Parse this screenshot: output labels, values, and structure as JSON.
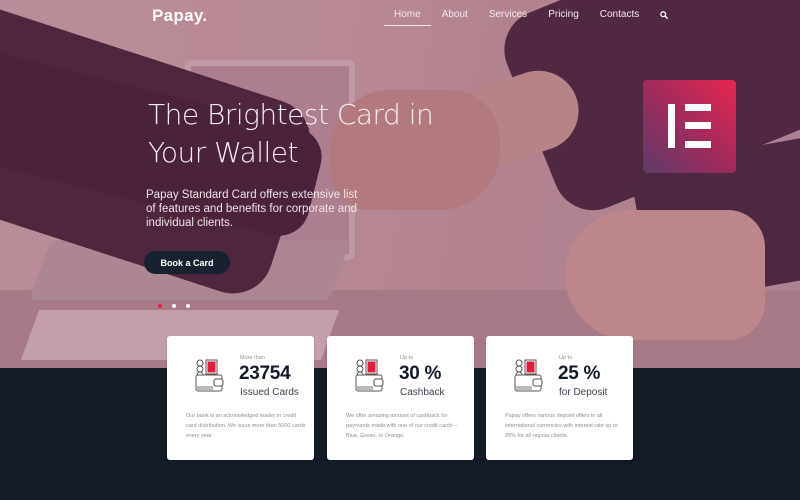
{
  "brand": {
    "logo": "Papay."
  },
  "nav": {
    "items": [
      {
        "label": "Home",
        "active": true
      },
      {
        "label": "About",
        "active": false
      },
      {
        "label": "Services",
        "active": false
      },
      {
        "label": "Pricing",
        "active": false
      },
      {
        "label": "Contacts",
        "active": false
      }
    ],
    "search_icon": "search-icon"
  },
  "hero": {
    "headline_line1": "The Brightest Card in",
    "headline_line2": "Your Wallet",
    "subtext": "Papay Standard Card offers extensive list of features and benefits for corporate and individual clients.",
    "cta_label": "Book a Card",
    "slider": {
      "total": 3,
      "active_index": 0
    },
    "badge_icon": "elementor-icon"
  },
  "colors": {
    "accent_red": "#e31b3d",
    "dark_navy": "#141b28",
    "badge_gradient_start": "#5d3b68",
    "badge_gradient_end": "#e7264f"
  },
  "stats": [
    {
      "icon": "wallet-coins-icon",
      "pre": "More than",
      "value": "23754",
      "label": "Issued Cards",
      "desc": "Our bank is an acknowledged leader in credit card distribution. We issue more than 5000 cards every year"
    },
    {
      "icon": "wallet-coins-icon",
      "pre": "Up to",
      "value": "30 %",
      "label": "Cashback",
      "desc": "We offer amazing amount of cashback for payments made with one of our credit cards – Blue, Green, or Orange."
    },
    {
      "icon": "wallet-coins-icon",
      "pre": "Up to",
      "value": "25 %",
      "label": "for Deposit",
      "desc": "Papay offers various deposit offers in all international currencies with interest rate up to 25% for all regular clients."
    }
  ]
}
